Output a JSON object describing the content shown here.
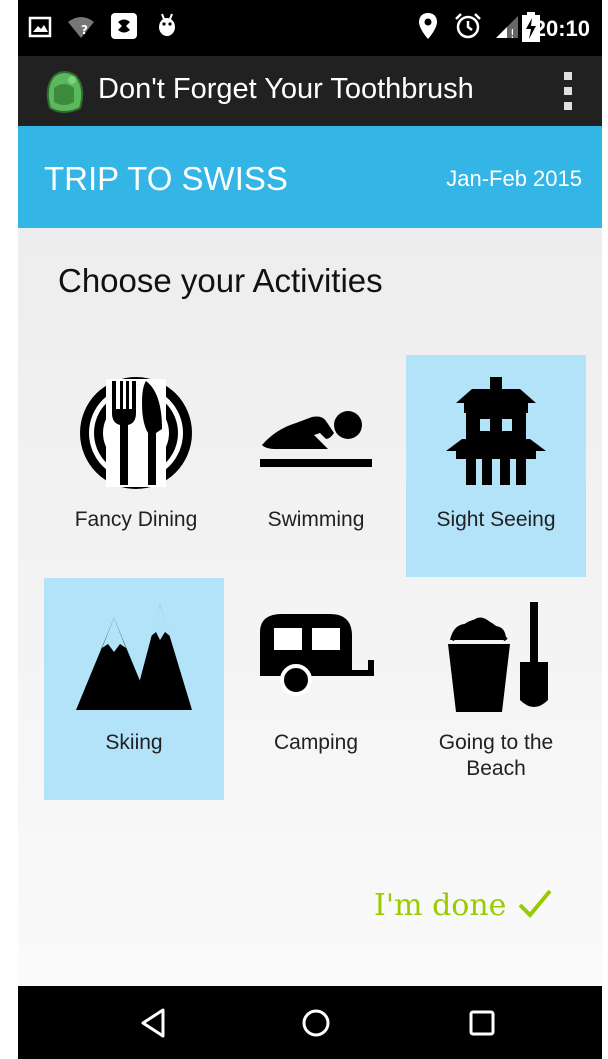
{
  "status_bar": {
    "time": "20:10",
    "icons_left": [
      "gallery-icon",
      "wifi-unknown-icon",
      "app-notification-icon",
      "android-debug-icon"
    ],
    "icons_right": [
      "location-pin-icon",
      "alarm-icon",
      "signal-icon",
      "battery-charging-icon"
    ]
  },
  "app_bar": {
    "title": "Don't Forget Your Toothbrush",
    "icon": "backpack-icon",
    "menu_icon": "overflow-menu-icon"
  },
  "trip": {
    "name": "TRIP TO SWISS",
    "dates": "Jan-Feb 2015"
  },
  "section_title": "Choose your Activities",
  "activities": [
    {
      "label": "Fancy Dining",
      "icon": "fancy-dining-icon",
      "selected": false
    },
    {
      "label": "Swimming",
      "icon": "swimming-icon",
      "selected": false
    },
    {
      "label": "Sight Seeing",
      "icon": "pagoda-icon",
      "selected": true
    },
    {
      "label": "Skiing",
      "icon": "mountains-icon",
      "selected": true
    },
    {
      "label": "Camping",
      "icon": "camper-trailer-icon",
      "selected": false
    },
    {
      "label": "Going to the Beach",
      "icon": "bucket-spade-icon",
      "selected": false
    }
  ],
  "done_label": "I'm done",
  "colors": {
    "accent_header": "#33b5e5",
    "selected_tile": "#b3e3f9",
    "done_green": "#99cc00",
    "app_bar": "#212121"
  },
  "nav_bar": [
    "back-icon",
    "home-icon",
    "recents-icon"
  ]
}
